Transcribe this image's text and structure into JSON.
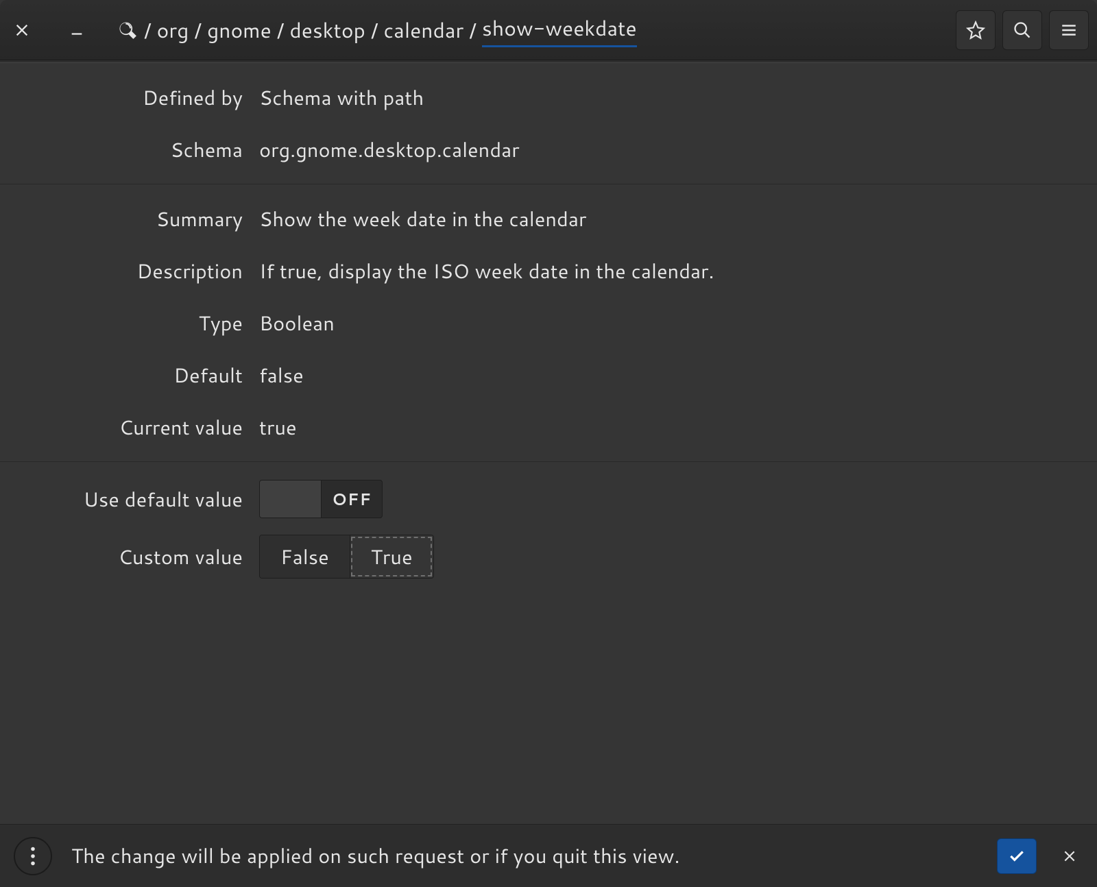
{
  "breadcrumb": {
    "segments": [
      "org",
      "gnome",
      "desktop",
      "calendar",
      "show-weekdate"
    ],
    "active_index": 4
  },
  "fields": {
    "defined_by": {
      "label": "Defined by",
      "value": "Schema with path"
    },
    "schema": {
      "label": "Schema",
      "value": "org.gnome.desktop.calendar"
    },
    "summary": {
      "label": "Summary",
      "value": "Show the week date in the calendar"
    },
    "description": {
      "label": "Description",
      "value": "If true, display the ISO week date in the calendar."
    },
    "type": {
      "label": "Type",
      "value": "Boolean"
    },
    "default": {
      "label": "Default",
      "value": "false"
    },
    "current": {
      "label": "Current value",
      "value": "true"
    }
  },
  "controls": {
    "use_default": {
      "label": "Use default value",
      "state": "OFF"
    },
    "custom_value": {
      "label": "Custom value",
      "option_false": "False",
      "option_true": "True",
      "selected": "True"
    }
  },
  "actionbar": {
    "message": "The change will be applied on such request or if you quit this view."
  }
}
